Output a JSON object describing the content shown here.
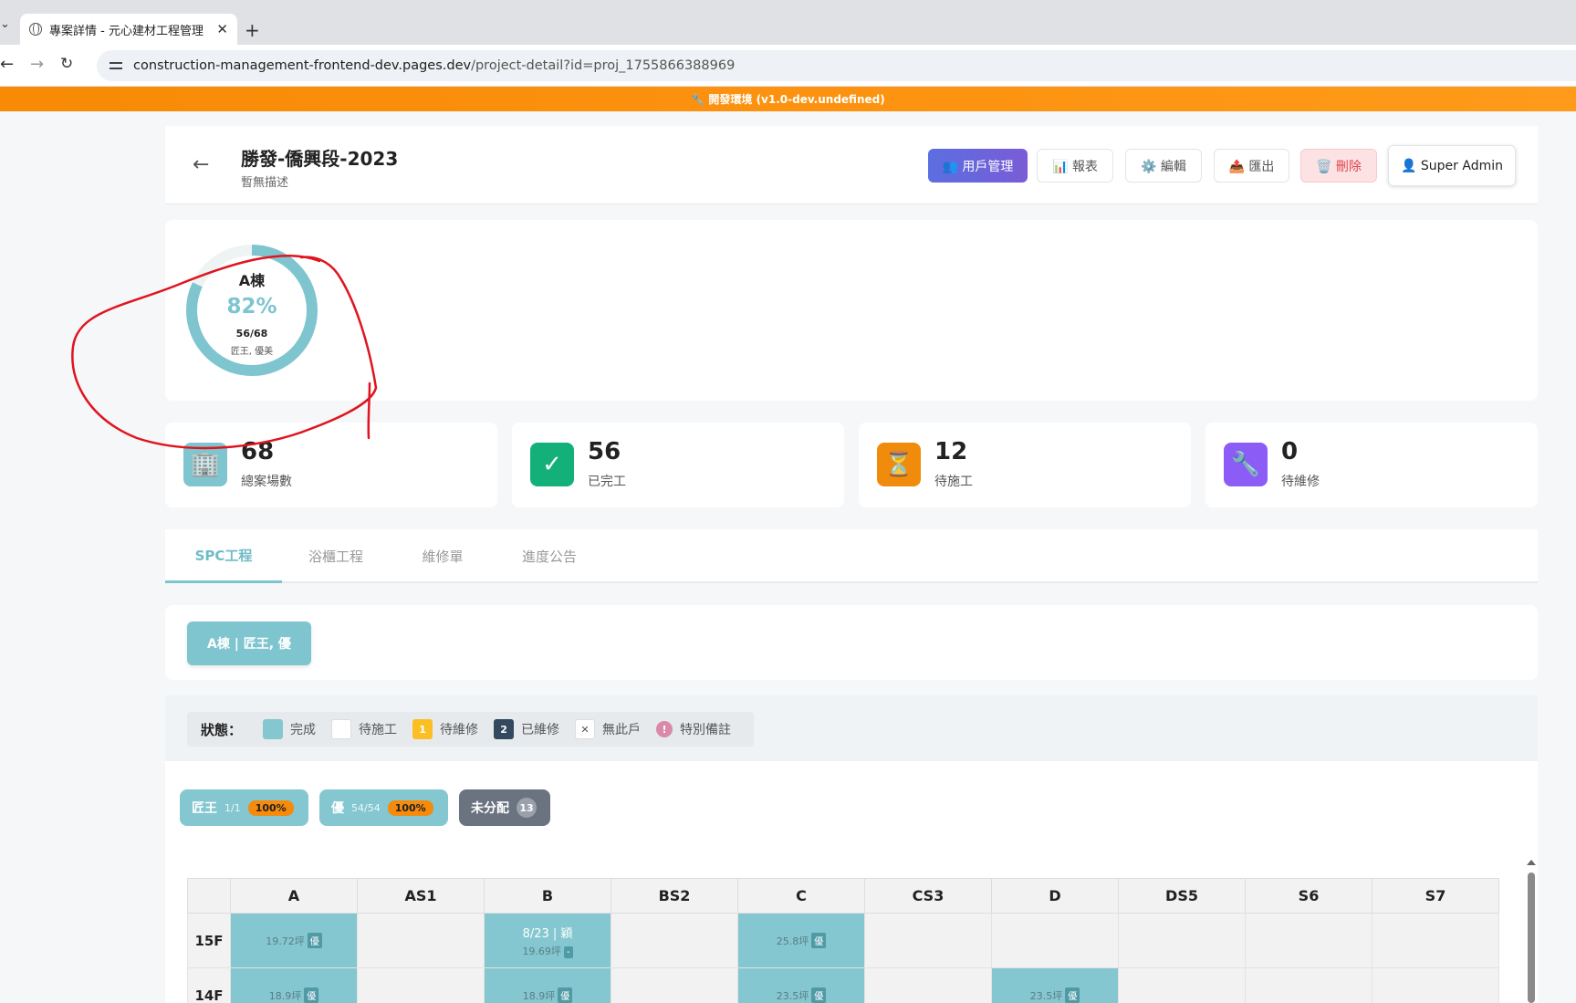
{
  "browser": {
    "tab_title": "專案詳情 - 元心建材工程管理",
    "url_host": "construction-management-frontend-dev.pages.dev",
    "url_path": "/project-detail?id=proj_1755866388969"
  },
  "env_banner": "🔧 開發環境 (v1.0-dev.undefined)",
  "header": {
    "title": "勝發-僑興段-2023",
    "description": "暫無描述",
    "buttons": {
      "users": "👥 用戶管理",
      "reports": "📊 報表",
      "edit": "⚙️ 編輯",
      "export": "📤 匯出",
      "delete": "🗑️ 刪除",
      "user": "👤 Super Admin"
    }
  },
  "building_progress": {
    "name": "A棟",
    "percent": "82%",
    "percent_value": 0.82,
    "count": "56/68",
    "teams": "匠王, 優美"
  },
  "stats": [
    {
      "value": "68",
      "label": "總案場數",
      "icon": "🏢",
      "color": "#7ec5cf"
    },
    {
      "value": "56",
      "label": "已完工",
      "icon": "✓",
      "color": "#14b07a"
    },
    {
      "value": "12",
      "label": "待施工",
      "icon": "⏳",
      "color": "#f08b0b"
    },
    {
      "value": "0",
      "label": "待維修",
      "icon": "🔧",
      "color": "#8b5cf6"
    }
  ],
  "tabs": [
    "SPC工程",
    "浴櫃工程",
    "維修單",
    "進度公告"
  ],
  "building_button": "A棟 | 匠王, 優",
  "legend": {
    "title": "狀態：",
    "items": [
      "完成",
      "待施工",
      "待維修",
      "已維修",
      "無此戶",
      "特別備註"
    ],
    "pending_repair_num": "1",
    "repaired_num": "2",
    "none_mark": "✕",
    "note_mark": "!"
  },
  "teams": [
    {
      "name": "匠王",
      "progress": "1/1",
      "pct": "100%"
    },
    {
      "name": "優",
      "progress": "54/54",
      "pct": "100%"
    },
    {
      "name": "未分配",
      "count": "13"
    }
  ],
  "grid": {
    "columns": [
      "A",
      "AS1",
      "B",
      "BS2",
      "C",
      "CS3",
      "D",
      "DS5",
      "S6",
      "S7"
    ],
    "rows": [
      {
        "floor": "15F",
        "cells": {
          "A": {
            "area": "19.72坪",
            "tag": "優"
          },
          "B": {
            "date": "8/23 | 穎",
            "area": "19.69坪",
            "tag": "-"
          },
          "C": {
            "area": "25.8坪",
            "tag": "優"
          }
        }
      },
      {
        "floor": "14F",
        "cells": {
          "A": {
            "area": "18.9坪",
            "tag": "優"
          },
          "B": {
            "area": "18.9坪",
            "tag": "優"
          },
          "C": {
            "area": "23.5坪",
            "tag": "優"
          },
          "D": {
            "area": "23.5坪",
            "tag": "優"
          }
        }
      }
    ]
  },
  "colors": {
    "accent": "#7ec5cf",
    "env_banner": "#f88a05",
    "annotation": "#e0141e"
  }
}
